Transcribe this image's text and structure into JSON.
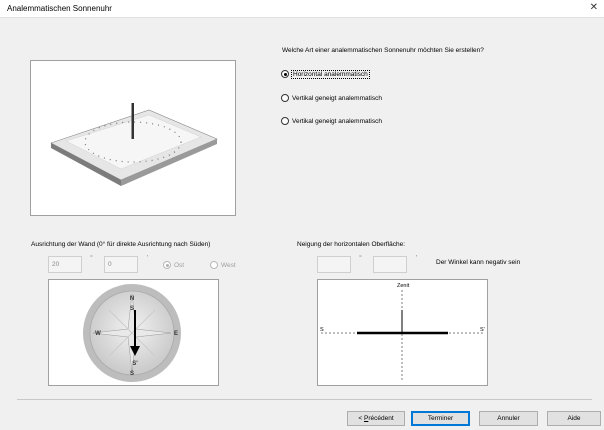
{
  "window": {
    "title": "Analemmatischen Sonnenuhr"
  },
  "question": "Welche Art einer analemmatischen Sonnenuhr möchten Sie erstellen?",
  "dial_types": [
    {
      "label": "Horizontal analemmatisch",
      "checked": true
    },
    {
      "label": "Vertikal geneigt analemmatisch",
      "checked": false
    },
    {
      "label": "Vertikal geneigt analemmatisch",
      "checked": false
    }
  ],
  "wall": {
    "label": "Ausrichtung der Wand (0° für direkte Ausrichtung nach Süden)",
    "degrees": "20",
    "degree_symbol": "°",
    "minutes": "0",
    "minute_symbol": "'",
    "ost_label": "Ost",
    "west_label": "West",
    "compass": {
      "north": "N",
      "south": "S",
      "west": "W",
      "east": "E",
      "south_prime": "S'"
    }
  },
  "slope": {
    "label": "Neigung der horizontalen Oberfläche:",
    "degrees": "",
    "degree_symbol": "°",
    "minutes": "",
    "minute_symbol": "'",
    "note": "Der Winkel kann negativ sein",
    "diagram": {
      "zenit": "Zenit",
      "s_left": "S",
      "s_right": "S'"
    }
  },
  "buttons": {
    "previous_prefix": "< ",
    "previous_accel": "P",
    "previous_rest": "récédent",
    "finish": "Terminer",
    "cancel": "Annuler",
    "help": "Aide"
  }
}
